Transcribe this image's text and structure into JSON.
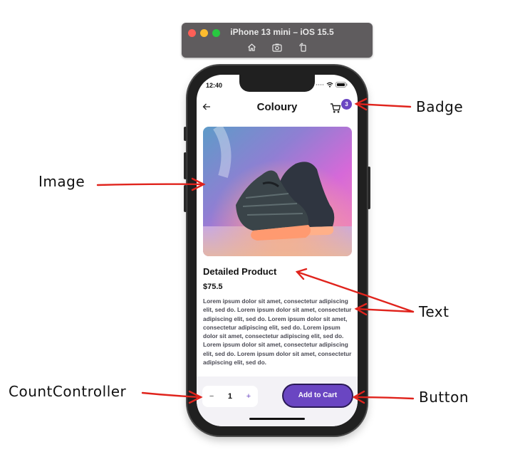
{
  "simulator": {
    "title": "iPhone 13 mini – iOS 15.5",
    "tools": [
      "home-icon",
      "screenshot-icon",
      "rotate-icon"
    ]
  },
  "status_bar": {
    "time": "12:40"
  },
  "app": {
    "title": "Colour​y",
    "cart_badge": "3"
  },
  "product": {
    "title": "Detailed Product",
    "price": "$75.5",
    "description": "Lorem ipsum dolor sit amet, consectetur adipiscing elit, sed do. Lorem ipsum dolor sit amet, consectetur adipiscing elit, sed do. Lorem ipsum dolor sit amet, consectetur adipiscing elit, sed do. Lorem ipsum dolor sit amet, consectetur adipiscing elit, sed do. Lorem ipsum dolor sit amet, consectetur adipiscing elit, sed do. Lorem ipsum dolor sit amet, consectetur adipiscing elit, sed do."
  },
  "counter": {
    "minus": "−",
    "value": "1",
    "plus": "+"
  },
  "add_button": "Add to Cart",
  "annotations": {
    "badge": "Badge",
    "image": "Image",
    "text": "Text",
    "count_controller": "CountController",
    "button": "Button"
  },
  "colors": {
    "accent": "#6a46c2",
    "arrow": "#e0231c"
  }
}
